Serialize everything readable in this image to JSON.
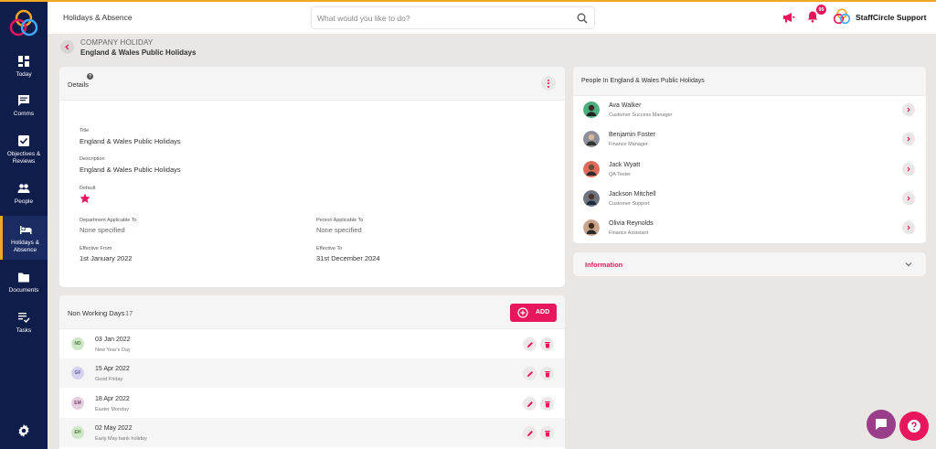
{
  "topbar": {
    "section_title": "Holidays & Absence",
    "search_placeholder": "What would you like to do?",
    "notification_count": "99",
    "brand_name": "StaffCircle Support"
  },
  "sidebar": {
    "items": [
      {
        "label": "Today",
        "icon": "dashboard-icon"
      },
      {
        "label": "Comms",
        "icon": "chat-icon"
      },
      {
        "label": "Objectives &\nReviews",
        "icon": "checkbox-icon"
      },
      {
        "label": "People",
        "icon": "people-icon"
      },
      {
        "label": "Holidays &\nAbsence",
        "icon": "bed-icon",
        "active": true
      },
      {
        "label": "Documents",
        "icon": "folder-icon"
      },
      {
        "label": "Tasks",
        "icon": "tasks-icon"
      }
    ]
  },
  "page": {
    "kicker": "COMPANY HOLIDAY",
    "heading": "England & Wales Public Holidays"
  },
  "details": {
    "header": "Details",
    "help": "?",
    "title_label": "Title",
    "title_value": "England & Wales Public Holidays",
    "description_label": "Description",
    "description_value": "England & Wales Public Holidays",
    "default_label": "Default",
    "dept_label": "Department Applicable To",
    "dept_value": "None specified",
    "person_label": "Person Applicable To",
    "person_value": "None specified",
    "from_label": "Effective From",
    "from_value": "1st January 2022",
    "to_label": "Effective To",
    "to_value": "31st December 2024"
  },
  "non_working_days": {
    "title": "Non Working Days",
    "count": "17",
    "add_label": "ADD",
    "rows": [
      {
        "initials": "ND",
        "date": "03 Jan 2022",
        "name": "New Year's Day",
        "bg": "#cfe7c8",
        "fg": "#4c7a3f"
      },
      {
        "initials": "GF",
        "date": "15 Apr 2022",
        "name": "Good Friday",
        "bg": "#d5d2ee",
        "fg": "#5a55a0"
      },
      {
        "initials": "EM",
        "date": "18 Apr 2022",
        "name": "Easter Monday",
        "bg": "#e4cfe0",
        "fg": "#7b4b73"
      },
      {
        "initials": "EH",
        "date": "02 May 2022",
        "name": "Early May bank holiday",
        "bg": "#cfe7c8",
        "fg": "#4c7a3f"
      }
    ]
  },
  "people": {
    "title": "People In England & Wales Public Holidays",
    "list": [
      {
        "name": "Ava Walker",
        "role": "Customer Success Manager",
        "color": "#4caf7d"
      },
      {
        "name": "Benjamin Foster",
        "role": "Finance Manager",
        "color": "#8a8f99"
      },
      {
        "name": "Jack Wyatt",
        "role": "QA Tester",
        "color": "#e06b5c"
      },
      {
        "name": "Jackson Mitchell",
        "role": "Customer Support",
        "color": "#6d7480"
      },
      {
        "name": "Olivia Reynolds",
        "role": "Finance Assistant",
        "color": "#c9a48a"
      }
    ]
  },
  "information": {
    "title": "Information"
  },
  "colors": {
    "accent": "#e8175d",
    "sidebar": "#0f1d4a",
    "highlight": "#f5a623"
  }
}
